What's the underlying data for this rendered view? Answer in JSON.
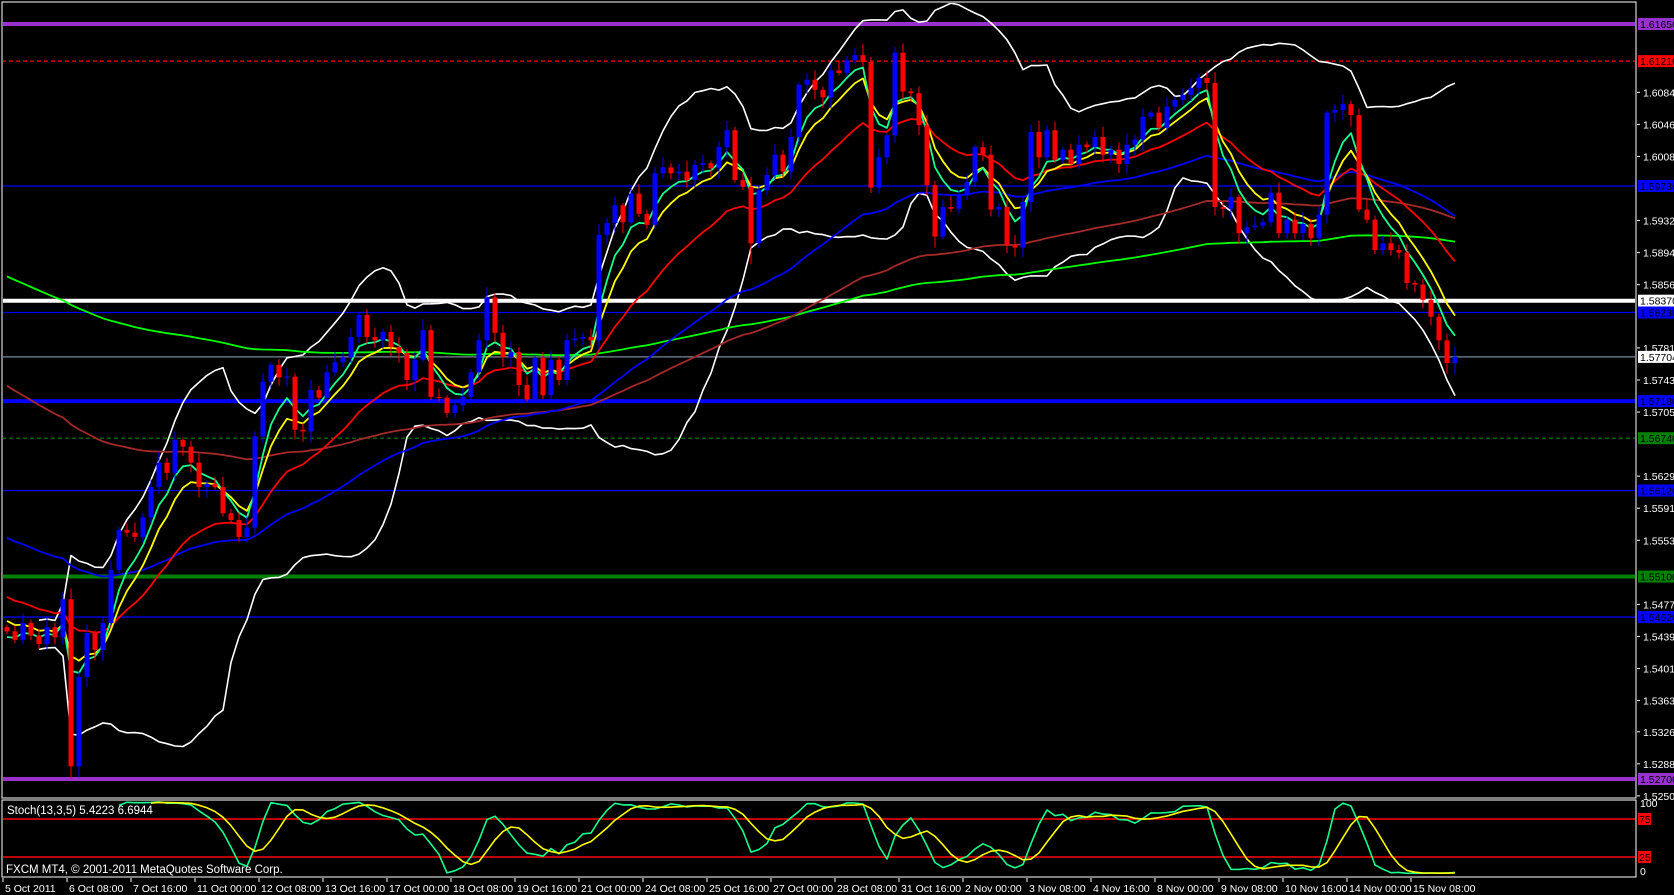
{
  "window": {
    "footer": "FXCM MT4, © 2001-2011 MetaQuotes Software Corp."
  },
  "colors": {
    "background": "#000000",
    "frame": "#ffffff",
    "bull": "#0000ff",
    "bear": "#ff0000",
    "axis_text": "#ffffff"
  },
  "chart_data": [
    {
      "type": "candlestick",
      "symbol_timeframe": "H4",
      "y_range": [
        1.525,
        1.6165
      ],
      "open_first": 1.545,
      "close": [
        1.5445,
        1.5435,
        1.5455,
        1.544,
        1.543,
        1.545,
        1.5438,
        1.5483,
        1.5285,
        1.5391,
        1.5443,
        1.5423,
        1.5455,
        1.5518,
        1.5565,
        1.5562,
        1.5557,
        1.558,
        1.5616,
        1.5645,
        1.5633,
        1.5672,
        1.5664,
        1.5645,
        1.5616,
        1.562,
        1.5616,
        1.5585,
        1.5577,
        1.5557,
        1.5568,
        1.5676,
        1.5741,
        1.5761,
        1.5746,
        1.5747,
        1.5684,
        1.5682,
        1.5731,
        1.5722,
        1.5752,
        1.5764,
        1.577,
        1.5794,
        1.582,
        1.5794,
        1.579,
        1.58,
        1.5782,
        1.5775,
        1.5743,
        1.5767,
        1.5802,
        1.5723,
        1.5722,
        1.5704,
        1.5713,
        1.5723,
        1.5752,
        1.579,
        1.5841,
        1.5799,
        1.577,
        1.5776,
        1.5737,
        1.572,
        1.5769,
        1.5725,
        1.5767,
        1.5743,
        1.579,
        1.5792,
        1.5794,
        1.579,
        1.5915,
        1.5929,
        1.595,
        1.593,
        1.5964,
        1.594,
        1.5927,
        1.5988,
        1.5995,
        1.5988,
        1.599,
        1.598,
        1.5998,
        1.6,
        1.5994,
        1.6019,
        1.6039,
        1.598,
        1.5972,
        1.5905,
        1.5968,
        1.5986,
        1.601,
        1.599,
        1.6031,
        1.6093,
        1.6099,
        1.6087,
        1.6078,
        1.611,
        1.6107,
        1.6122,
        1.6128,
        1.612,
        1.5971,
        1.6007,
        1.6033,
        1.6131,
        1.6085,
        1.6083,
        1.6045,
        1.5974,
        1.5913,
        1.5948,
        1.5946,
        1.5962,
        1.5978,
        1.6019,
        1.601,
        1.5945,
        1.5948,
        1.5903,
        1.59,
        1.5954,
        1.6037,
        1.6007,
        1.6039,
        1.6004,
        1.6016,
        1.5999,
        1.6022,
        1.6019,
        1.6031,
        1.601,
        1.6016,
        1.5999,
        1.6022,
        1.6028,
        1.6055,
        1.606,
        1.6042,
        1.6067,
        1.6075,
        1.6081,
        1.6089,
        1.6101,
        1.6095,
        1.5948,
        1.5946,
        1.596,
        1.5917,
        1.5924,
        1.5926,
        1.593,
        1.5965,
        1.5917,
        1.5933,
        1.5917,
        1.5928,
        1.5911,
        1.5939,
        1.606,
        1.6063,
        1.607,
        1.6057,
        1.5945,
        1.5933,
        1.5897,
        1.5905,
        1.5897,
        1.5894,
        1.5858,
        1.5856,
        1.5838,
        1.5818,
        1.579,
        1.5763,
        1.57704
      ],
      "low_overrides": {
        "8": 1.527,
        "9": 1.5272,
        "93": 1.588
      },
      "indicators": [
        {
          "name": "EMA 200",
          "period": 200,
          "seed": 1.587,
          "color": "#00ff00"
        },
        {
          "name": "EMA 100",
          "period": 100,
          "seed": 1.5742,
          "color": "#a52a2a"
        },
        {
          "name": "EMA 55",
          "period": 55,
          "seed": 1.556,
          "color": "#0000ff"
        },
        {
          "name": "EMA 21",
          "period": 21,
          "seed": 1.549,
          "color": "#ff0000"
        },
        {
          "name": "EMA 8",
          "period": 8,
          "seed": 1.5461,
          "color": "#ffff00"
        },
        {
          "name": "EMA 5",
          "period": 5,
          "seed": 1.5435,
          "color": "#1aff8c"
        }
      ],
      "bollinger": {
        "period": 20,
        "deviation": 2,
        "color": "#ffffff"
      },
      "price_ticks": [
        "1.60840",
        "1.60460",
        "1.60080",
        "1.59320",
        "1.58940",
        "1.58560",
        "1.57810",
        "1.57430",
        "1.57050",
        "1.56290",
        "1.55910",
        "1.55530",
        "1.54770",
        "1.54390",
        "1.54010",
        "1.53630",
        "1.53260",
        "1.52880",
        "1.52500"
      ],
      "levels": [
        {
          "price": "1.61650",
          "color": "#9932cc",
          "weight": "thick",
          "style": "solid",
          "label_text_color": "#000000"
        },
        {
          "price": "1.61210",
          "color": "#ff0000",
          "weight": "thin",
          "style": "dashed",
          "label_text_color": "#000000"
        },
        {
          "price": "1.59730",
          "color": "#0000ff",
          "weight": "thin",
          "style": "solid",
          "label_text_color": "#000000"
        },
        {
          "price": "1.58370",
          "color": "#ffffff",
          "weight": "thick",
          "style": "solid",
          "label_text_color": "#000000"
        },
        {
          "price": "1.58230",
          "color": "#0000ff",
          "weight": "thin",
          "style": "solid",
          "label_text_color": "#000000"
        },
        {
          "price": "1.57704",
          "color": "#778899",
          "weight": "thin",
          "style": "solid",
          "label_bg": "#ffffff",
          "label_text_color": "#000000"
        },
        {
          "price": "1.57180",
          "color": "#0000ff",
          "weight": "thick",
          "style": "solid",
          "label_text_color": "#000000"
        },
        {
          "price": "1.56740",
          "color": "#008000",
          "weight": "thin",
          "style": "dashed",
          "label_text_color": "#000000"
        },
        {
          "price": "1.56120",
          "color": "#0000ff",
          "weight": "thin",
          "style": "solid",
          "label_text_color": "#000000"
        },
        {
          "price": "1.55100",
          "color": "#008000",
          "weight": "thick",
          "style": "solid",
          "label_text_color": "#000000"
        },
        {
          "price": "1.54620",
          "color": "#0000ff",
          "weight": "thin",
          "style": "solid",
          "label_text_color": "#000000"
        },
        {
          "price": "1.52700",
          "color": "#9932cc",
          "weight": "thick",
          "style": "solid",
          "label_text_color": "#000000"
        }
      ],
      "time_labels": [
        "5 Oct 2011",
        "6 Oct 08:00",
        "7 Oct 16:00",
        "11 Oct 00:00",
        "12 Oct 08:00",
        "13 Oct 16:00",
        "17 Oct 00:00",
        "18 Oct 08:00",
        "19 Oct 16:00",
        "21 Oct 00:00",
        "24 Oct 08:00",
        "25 Oct 16:00",
        "27 Oct 00:00",
        "28 Oct 08:00",
        "31 Oct 16:00",
        "2 Nov 00:00",
        "3 Nov 08:00",
        "4 Nov 16:00",
        "8 Nov 00:00",
        "9 Nov 08:00",
        "10 Nov 16:00",
        "14 Nov 00:00",
        "15 Nov 08:00"
      ],
      "bars_per_time_label": 8
    },
    {
      "type": "line",
      "title": "Stoch(13,3,5) 5.4223 6.6944",
      "k_period": 13,
      "slowing": 3,
      "d_period": 5,
      "main_color": "#1aff8c",
      "signal_color": "#ffff00",
      "y_range": [
        0,
        100
      ],
      "levels": [
        {
          "value": "75",
          "color": "#ff0000"
        },
        {
          "value": "25",
          "color": "#ff0000"
        }
      ],
      "scale_labels": [
        "100",
        "0"
      ]
    }
  ]
}
